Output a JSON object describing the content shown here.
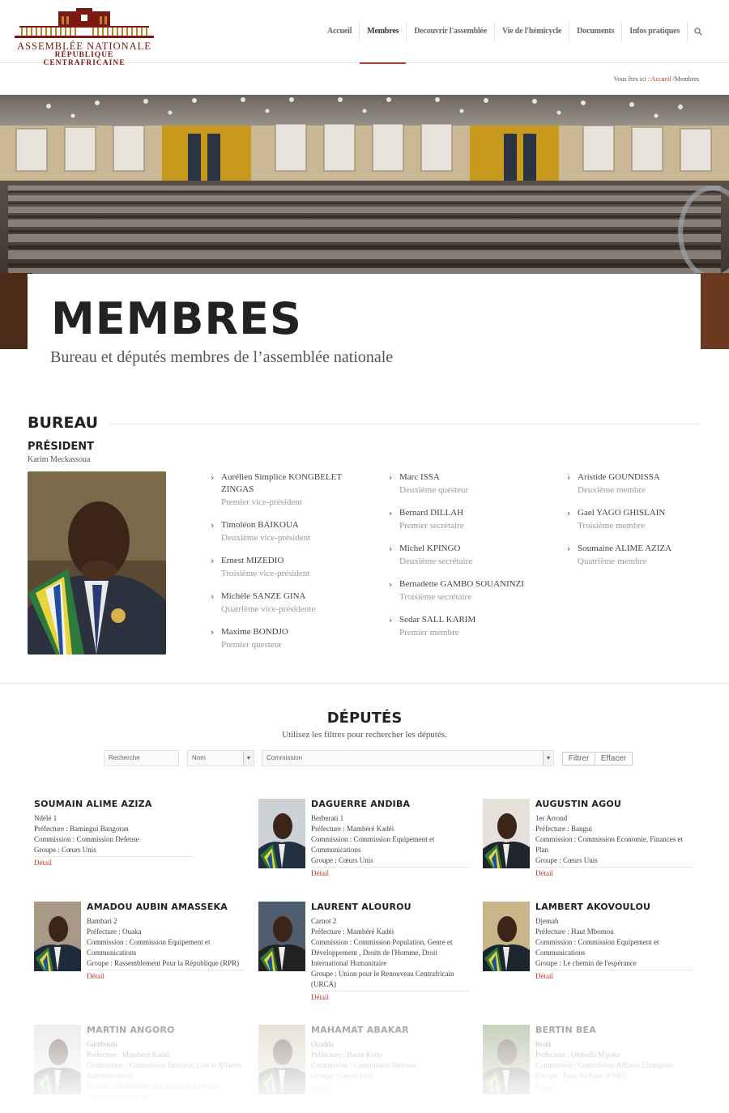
{
  "header": {
    "logo_line1": "ASSEMBLÉE NATIONALE",
    "logo_line2": "RÉPUBLIQUE CENTRAFRICAINE",
    "nav": [
      "Accueil",
      "Membres",
      "Decouvrir l'assemblée",
      "Vie de l'hémicycle",
      "Documents",
      "Infos pratiques"
    ],
    "active_nav": "Membres"
  },
  "breadcrumb": {
    "prefix": "Vous êtes ici :",
    "home": "Accueil",
    "sep": "/",
    "current": "Membres"
  },
  "hero": {
    "title": "MEMBRES",
    "subtitle": "Bureau et députés membres de l’assemblée nationale"
  },
  "bureau": {
    "heading": "BUREAU",
    "president_heading": "PRÉSIDENT",
    "president_name": "Karim Meckassoua",
    "col1": [
      {
        "name": "Aurélien Simplice KONGBELET ZINGAS",
        "role": "Premier vice-président"
      },
      {
        "name": "Timoléon BAIKOUA",
        "role": "Deuxième vice-président"
      },
      {
        "name": "Ernest MIZEDIO",
        "role": "Troisième vice-président"
      },
      {
        "name": "Michèle SANZE GINA",
        "role": "Quatrième vice-présidente"
      },
      {
        "name": "Maxime BONDJO",
        "role": "Premier questeur"
      }
    ],
    "col2": [
      {
        "name": "Marc ISSA",
        "role": "Deuxième questeur"
      },
      {
        "name": "Bernard DILLAH",
        "role": "Premier secrétaire"
      },
      {
        "name": "Michel KPINGO",
        "role": "Deuxième secrétaire"
      },
      {
        "name": "Bernadette GAMBO SOUANINZI",
        "role": "Troisième secrétaire"
      },
      {
        "name": "Sedar SALL KARIM",
        "role": "Premier membre"
      }
    ],
    "col3": [
      {
        "name": "Aristide GOUNDISSA",
        "role": "Deuxième membre"
      },
      {
        "name": "Gael YAGO GHISLAIN",
        "role": "Troisième membre"
      },
      {
        "name": "Soumaine ALIME AZIZA",
        "role": "Quatrième membre"
      }
    ]
  },
  "deputes": {
    "heading": "DÉPUTÉS",
    "subtitle": "Utilisez les filtres pour rechercher les députés.",
    "filters": {
      "search": "Recherche",
      "sort": "Nom",
      "commission": "Commission",
      "filter_btn": "Filtrer",
      "clear_btn": "Effacer"
    },
    "detail_label": "Détail",
    "cards": [
      {
        "name": "SOUMAIN ALIME AZIZA",
        "lines": [
          "Ndélé 1",
          "Préfecture : Bamingui Bangoran",
          "Commission : Commission Defense",
          "Groupe : Cœurs Unis"
        ],
        "photo": false
      },
      {
        "name": "DAGUERRE ANDIBA",
        "lines": [
          "Berberati 1",
          "Préfecture : Mambéré Kadéi",
          "Commission : Commission Equipement et Communications",
          "Groupe : Cœurs Unis"
        ],
        "photo": true
      },
      {
        "name": "AUGUSTIN AGOU",
        "lines": [
          "1er Arrond",
          "Préfecture : Bangui",
          "Commission : Commission Economie, Finances et Plan",
          "Groupe : Cœurs Unis"
        ],
        "photo": true
      },
      {
        "name": "AMADOU AUBIN AMASSEKA",
        "lines": [
          "Bambari 2",
          "Préfecture : Ouaka",
          "Commission : Commission Equipement et Communications",
          "Groupe : Rassemblement Pour la République (RPR)"
        ],
        "photo": true
      },
      {
        "name": "LAURENT ALOUROU",
        "lines": [
          "Carnot 2",
          "Préfecture : Mambéré Kadéi",
          "Commission : Commission Population, Genre et Développement , Droits de l'Homme, Droit International Humanitaire",
          "Groupe : Union pour le Renouveau Centrafricain (URCA)"
        ],
        "photo": true
      },
      {
        "name": "LAMBERT AKOVOULOU",
        "lines": [
          "Djemah",
          "Préfecture : Haut Mbomou",
          "Commission : Commission Equipement et Communications",
          "Groupe : Le chemin de l'espérance"
        ],
        "photo": true
      },
      {
        "name": "MARTIN ANGORO",
        "lines": [
          "Gamboula",
          "Préfecture : Mambéré Kadéi",
          "Commission : Commission Intérieur, Lois et Affaires Administratives",
          "Groupe : Mouvement de Libération du Peuple Centrafricain (MLPC)"
        ],
        "photo": true
      },
      {
        "name": "MAHAMAT ABAKAR",
        "lines": [
          "Ouadda",
          "Préfecture : Haute Kotto",
          "Commission : Commission Défense",
          "Groupe : Cœurs Unis"
        ],
        "photo": true
      },
      {
        "name": "BERTIN BEA",
        "lines": [
          "Boali",
          "Préfecture : Ombella M'poko",
          "Commission : Commission Affaires Etrangères",
          "Groupe : Kwa Na Kwa (KNK)"
        ],
        "photo": true
      }
    ]
  }
}
